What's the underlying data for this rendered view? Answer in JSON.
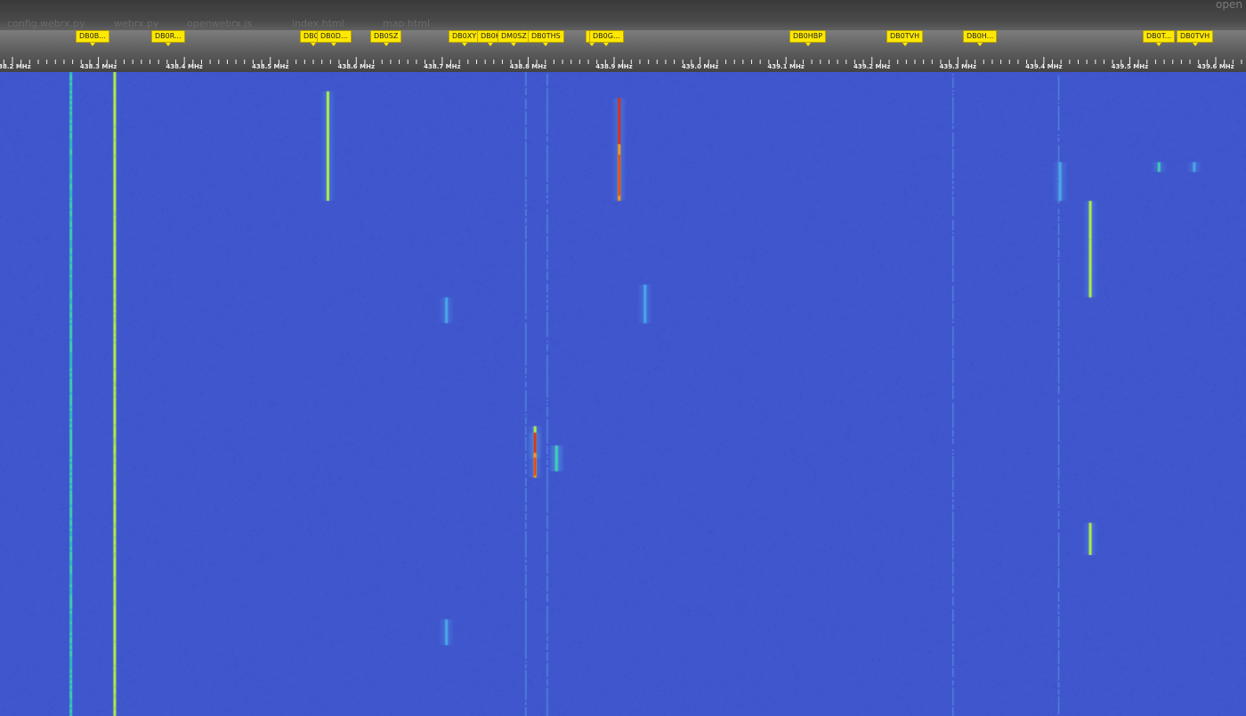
{
  "browser": {
    "tabs": [
      "config.webrx.py",
      "webrx.py",
      "openwebrx.js",
      "index.html",
      "map.html"
    ],
    "corner_label": "open"
  },
  "scale": {
    "frequency_labels": [
      {
        "label": "438.2 MHz",
        "mhz": 438.2
      },
      {
        "label": "438.3 MHz",
        "mhz": 438.3
      },
      {
        "label": "438.4 MHz",
        "mhz": 438.4
      },
      {
        "label": "438.5 MHz",
        "mhz": 438.5
      },
      {
        "label": "438.6 MHz",
        "mhz": 438.6
      },
      {
        "label": "438.7 MHz",
        "mhz": 438.7
      },
      {
        "label": "438.8 MHz",
        "mhz": 438.8
      },
      {
        "label": "438.9 MHz",
        "mhz": 438.9
      },
      {
        "label": "439.0 MHz",
        "mhz": 439.0
      },
      {
        "label": "439.1 MHz",
        "mhz": 439.1
      },
      {
        "label": "439.2 MHz",
        "mhz": 439.2
      },
      {
        "label": "439.3 MHz",
        "mhz": 439.3
      },
      {
        "label": "439.4 MHz",
        "mhz": 439.4
      },
      {
        "label": "439.5 MHz",
        "mhz": 439.5
      },
      {
        "label": "439.6 MHz",
        "mhz": 439.6
      }
    ]
  },
  "bookmarks": [
    {
      "label": "DB0B...",
      "mhz": 438.293
    },
    {
      "label": "DB0R...",
      "mhz": 438.381
    },
    {
      "label": "DB0V",
      "mhz": 438.55
    },
    {
      "label": "DB0D...",
      "mhz": 438.574
    },
    {
      "label": "DB0SZ",
      "mhz": 438.634
    },
    {
      "label": "DB0XY",
      "mhz": 438.725
    },
    {
      "label": "DB0K",
      "mhz": 438.756
    },
    {
      "label": "DM0SZ",
      "mhz": 438.784
    },
    {
      "label": "DB0THS",
      "mhz": 438.821
    },
    {
      "label": "D",
      "mhz": 438.874
    },
    {
      "label": "DB0G...",
      "mhz": 438.891
    },
    {
      "label": "DB0HBP",
      "mhz": 439.125
    },
    {
      "label": "DB0TVH",
      "mhz": 439.238
    },
    {
      "label": "DB0H...",
      "mhz": 439.326
    },
    {
      "label": "DB0T...",
      "mhz": 439.534
    },
    {
      "label": "DB0TVH",
      "mhz": 439.576
    }
  ],
  "waterfall": {
    "colors": {
      "background": "#3f56cd",
      "weak": "#4aa8e8",
      "medium": "#3fd0b0",
      "strong": "#b8f040",
      "peak": "#e03010",
      "hot": "#f5a020"
    },
    "span_mhz": [
      438.2,
      439.6
    ],
    "signals": [
      {
        "name": "continuous-carrier-1",
        "mhz": 438.268,
        "start": 0.0,
        "end": 1.0,
        "width_khz": 2.4,
        "level": "medium"
      },
      {
        "name": "continuous-carrier-2",
        "mhz": 438.319,
        "start": 0.0,
        "end": 1.0,
        "width_khz": 2.4,
        "level": "strong"
      },
      {
        "name": "db0v-burst",
        "mhz": 438.567,
        "start": 0.03,
        "end": 0.2,
        "width_khz": 1.2,
        "level": "strong"
      },
      {
        "name": "db0g-burst",
        "mhz": 438.906,
        "start": 0.04,
        "end": 0.2,
        "width_khz": 1.6,
        "level": "peak"
      },
      {
        "name": "dm0sz-burst",
        "mhz": 438.808,
        "start": 0.55,
        "end": 0.6,
        "width_khz": 0.8,
        "level": "strong"
      },
      {
        "name": "dm0sz-burst-2",
        "mhz": 438.808,
        "start": 0.56,
        "end": 0.63,
        "width_khz": 1.0,
        "level": "peak"
      },
      {
        "name": "ths-burst",
        "mhz": 438.833,
        "start": 0.58,
        "end": 0.62,
        "width_khz": 0.7,
        "level": "medium"
      },
      {
        "name": "ths-burst-2",
        "mhz": 438.833,
        "start": 0.58,
        "end": 0.62,
        "width_khz": 0.7,
        "level": "medium"
      },
      {
        "name": "small-burst-1",
        "mhz": 438.705,
        "start": 0.35,
        "end": 0.39,
        "width_khz": 0.6,
        "level": "weak"
      },
      {
        "name": "small-burst-2",
        "mhz": 438.705,
        "start": 0.85,
        "end": 0.89,
        "width_khz": 0.6,
        "level": "weak"
      },
      {
        "name": "small-burst-3",
        "mhz": 438.936,
        "start": 0.33,
        "end": 0.39,
        "width_khz": 0.6,
        "level": "weak"
      },
      {
        "name": "right-burst-1",
        "mhz": 439.454,
        "start": 0.2,
        "end": 0.26,
        "width_khz": 1.0,
        "level": "strong"
      },
      {
        "name": "right-burst-2",
        "mhz": 439.454,
        "start": 0.26,
        "end": 0.35,
        "width_khz": 1.0,
        "level": "strong"
      },
      {
        "name": "right-burst-3",
        "mhz": 439.454,
        "start": 0.7,
        "end": 0.75,
        "width_khz": 1.0,
        "level": "strong"
      },
      {
        "name": "dh-burst",
        "mhz": 439.419,
        "start": 0.14,
        "end": 0.2,
        "width_khz": 1.0,
        "level": "weak"
      },
      {
        "name": "far-right-1",
        "mhz": 439.534,
        "start": 0.14,
        "end": 0.155,
        "width_khz": 0.5,
        "level": "medium"
      },
      {
        "name": "far-right-2",
        "mhz": 439.575,
        "start": 0.14,
        "end": 0.155,
        "width_khz": 0.5,
        "level": "weak"
      }
    ],
    "lines": [
      {
        "name": "spur-1",
        "mhz": 438.797,
        "level": "weak"
      },
      {
        "name": "spur-2",
        "mhz": 438.822,
        "level": "weak"
      },
      {
        "name": "spur-3",
        "mhz": 439.294,
        "level": "weak"
      },
      {
        "name": "spur-4",
        "mhz": 439.417,
        "level": "weak"
      }
    ]
  }
}
